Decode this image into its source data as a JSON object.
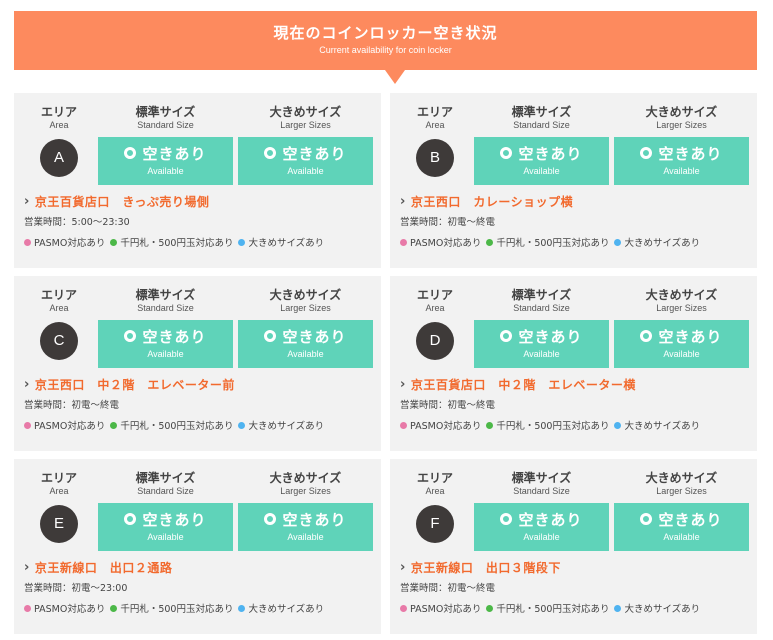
{
  "header": {
    "title": "現在のコインロッカー空き状況",
    "subtitle": "Current availability for coin locker"
  },
  "columns": {
    "area_jp": "エリア",
    "area_en": "Area",
    "std_jp": "標準サイズ",
    "std_en": "Standard Size",
    "lrg_jp": "大きめサイズ",
    "lrg_en": "Larger Sizes"
  },
  "status": {
    "jp": "空きあり",
    "en": "Available"
  },
  "legend": {
    "pasmo": "PASMO対応あり",
    "bills": "千円札・500円玉対応あり",
    "large": "大きめサイズあり",
    "colors": {
      "pasmo": "#e87aa8",
      "bills": "#4cb848",
      "large": "#4fb3f0"
    }
  },
  "colors": {
    "accent": "#fd8a5e",
    "available": "#5fd3b9",
    "location": "#f26a2e"
  },
  "lockers": [
    {
      "area": "A",
      "location": "京王百貨店口　きっぷ売り場側",
      "hours": "営業時間：5:00〜23:30"
    },
    {
      "area": "B",
      "location": "京王西口　カレーショップ横",
      "hours": "営業時間：初電〜終電"
    },
    {
      "area": "C",
      "location": "京王西口　中２階　エレベーター前",
      "hours": "営業時間：初電〜終電"
    },
    {
      "area": "D",
      "location": "京王百貨店口　中２階　エレベーター横",
      "hours": "営業時間：初電〜終電"
    },
    {
      "area": "E",
      "location": "京王新線口　出口２通路",
      "hours": "営業時間：初電〜23:00"
    },
    {
      "area": "F",
      "location": "京王新線口　出口３階段下",
      "hours": "営業時間：初電〜終電"
    }
  ]
}
